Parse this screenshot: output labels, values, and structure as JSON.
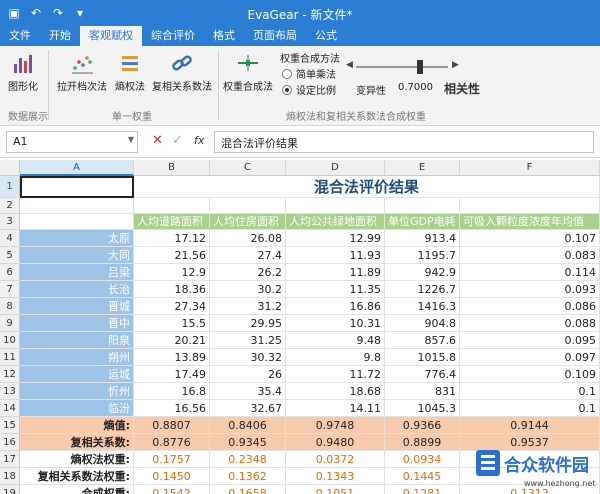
{
  "window": {
    "title": "EvaGear - 新文件*"
  },
  "ribbon_tabs": [
    "文件",
    "开始",
    "客观赋权",
    "综合评价",
    "格式",
    "页面布局",
    "公式"
  ],
  "active_tab_index": 2,
  "ribbon": {
    "btn_chart": "图形化",
    "btn_lakai": "拉开档次法",
    "btn_entropy": "熵权法",
    "btn_multi": "复相关系数法",
    "btn_combine": "权重合成法",
    "group_display": "数据展示",
    "group_single": "单一权重",
    "group_combined": "熵权法和复相关系数法合成权重",
    "method_title": "权重合成方法",
    "opt_simple": "简单乘法",
    "opt_ratio": "设定比例",
    "variability_label": "变异性",
    "ratio_value": "0.7000",
    "relevance_label": "相关性",
    "slider_fraction": 0.7
  },
  "formula_bar": {
    "cell_ref": "A1",
    "fx": "fx",
    "content": "混合法评价结果"
  },
  "columns": [
    "A",
    "B",
    "C",
    "D",
    "E",
    "F"
  ],
  "rows": [
    "1",
    "2",
    "3",
    "4",
    "5",
    "6",
    "7",
    "8",
    "9",
    "10",
    "11",
    "12",
    "13",
    "14",
    "15",
    "16",
    "17",
    "18",
    "19"
  ],
  "sheet": {
    "title": "混合法评价结果",
    "headers": [
      "人均道路面积",
      "人均住房面积",
      "人均公共绿地面积",
      "单位GDP电耗",
      "可吸入颗粒度浓度年均值"
    ],
    "cities": [
      {
        "name": "太原",
        "v": [
          "17.12",
          "26.08",
          "12.99",
          "913.4",
          "0.107"
        ]
      },
      {
        "name": "大同",
        "v": [
          "21.56",
          "27.4",
          "11.93",
          "1195.7",
          "0.083"
        ]
      },
      {
        "name": "吕梁",
        "v": [
          "12.9",
          "26.2",
          "11.89",
          "942.9",
          "0.114"
        ]
      },
      {
        "name": "长治",
        "v": [
          "18.36",
          "30.2",
          "11.35",
          "1226.7",
          "0.093"
        ]
      },
      {
        "name": "晋城",
        "v": [
          "27.34",
          "31.2",
          "16.86",
          "1416.3",
          "0.086"
        ]
      },
      {
        "name": "晋中",
        "v": [
          "15.5",
          "29.95",
          "10.31",
          "904.8",
          "0.088"
        ]
      },
      {
        "name": "阳泉",
        "v": [
          "20.21",
          "31.25",
          "9.48",
          "857.6",
          "0.095"
        ]
      },
      {
        "name": "朔州",
        "v": [
          "13.89",
          "30.32",
          "9.8",
          "1015.8",
          "0.097"
        ]
      },
      {
        "name": "运城",
        "v": [
          "17.49",
          "26",
          "11.72",
          "776.4",
          "0.109"
        ]
      },
      {
        "name": "忻州",
        "v": [
          "16.8",
          "35.4",
          "18.68",
          "831",
          "0.1"
        ]
      },
      {
        "name": "临汾",
        "v": [
          "16.56",
          "32.67",
          "14.11",
          "1045.3",
          "0.1"
        ]
      }
    ],
    "summary": [
      {
        "label": "熵值:",
        "v": [
          "0.8807",
          "0.8406",
          "0.9748",
          "0.9366",
          "0.9144"
        ],
        "style": "orange"
      },
      {
        "label": "复相关系数:",
        "v": [
          "0.8776",
          "0.9345",
          "0.9480",
          "0.8899",
          "0.9537"
        ],
        "style": "orange"
      },
      {
        "label": "熵权法权重:",
        "v": [
          "0.1757",
          "0.2348",
          "0.0372",
          "0.0934",
          ""
        ],
        "style": "red"
      },
      {
        "label": "复相关系数法权重:",
        "v": [
          "0.1450",
          "0.1362",
          "0.1343",
          "0.1445",
          ""
        ],
        "style": "red"
      },
      {
        "label": "合成权重:",
        "v": [
          "0.1542",
          "0.1658",
          "0.1051",
          "0.1281",
          "0.1312"
        ],
        "style": "red"
      }
    ]
  },
  "watermark": {
    "brand": "合众软件园",
    "url": "www.hezhong.net"
  },
  "colors": {
    "titlebar": "#2b7cd3",
    "city_fill": "#9dc3e6",
    "header_fill": "#a9d18e",
    "summary_fill": "#f8cbad",
    "weight_text": "#e46c0a"
  }
}
